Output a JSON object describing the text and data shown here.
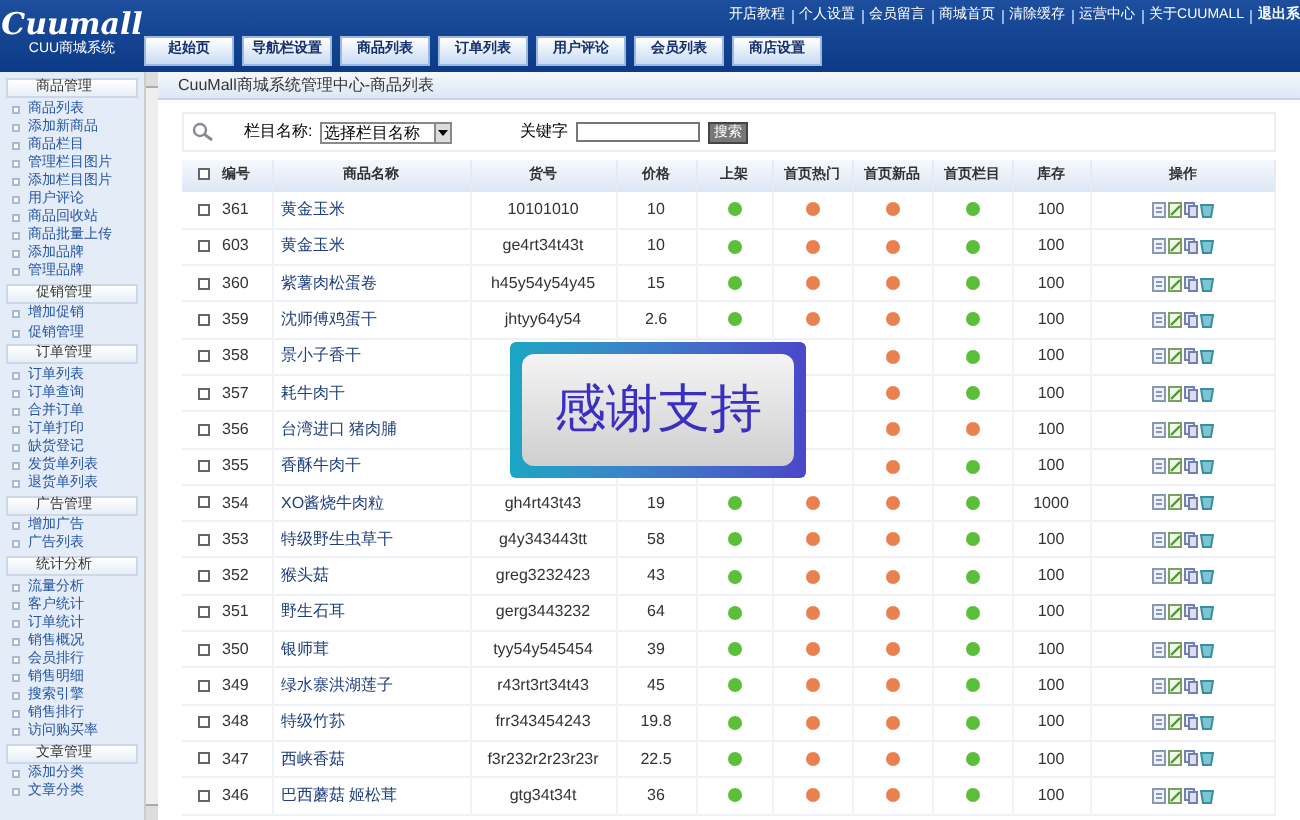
{
  "logo": {
    "title": "Cuumall",
    "subtitle": "CUU商城系统"
  },
  "top_links": [
    "开店教程",
    "个人设置",
    "会员留言",
    "商城首页",
    "清除缓存",
    "运营中心",
    "关于CUUMALL",
    "退出系"
  ],
  "nav_tabs": [
    {
      "label": "起始页",
      "selected": false
    },
    {
      "label": "导航栏设置",
      "selected": false
    },
    {
      "label": "商品列表",
      "selected": false
    },
    {
      "label": "订单列表",
      "selected": false
    },
    {
      "label": "用户评论",
      "selected": false
    },
    {
      "label": "会员列表",
      "selected": false
    },
    {
      "label": "商店设置",
      "selected": false
    }
  ],
  "sidebar": [
    {
      "title": "商品管理",
      "items": [
        "商品列表",
        "添加新商品",
        "商品栏目",
        "管理栏目图片",
        "添加栏目图片",
        "用户评论",
        "商品回收站",
        "商品批量上传",
        "添加品牌",
        "管理品牌"
      ]
    },
    {
      "title": "促销管理",
      "items": [
        "增加促销",
        "促销管理"
      ]
    },
    {
      "title": "订单管理",
      "items": [
        "订单列表",
        "订单查询",
        "合并订单",
        "订单打印",
        "缺货登记",
        "发货单列表",
        "退货单列表"
      ]
    },
    {
      "title": "广告管理",
      "items": [
        "增加广告",
        "广告列表"
      ]
    },
    {
      "title": "统计分析",
      "items": [
        "流量分析",
        "客户统计",
        "订单统计",
        "销售概况",
        "会员排行",
        "销售明细",
        "搜索引擎",
        "销售排行",
        "访问购买率"
      ]
    },
    {
      "title": "文章管理",
      "items": [
        "添加分类",
        "文章分类"
      ]
    }
  ],
  "breadcrumb": "CuuMall商城系统管理中心-商品列表",
  "search": {
    "category_label": "栏目名称:",
    "category_value": "选择栏目名称",
    "keyword_label": "关键字",
    "button": "搜索"
  },
  "table": {
    "select_all_checked": false,
    "columns": [
      "编号",
      "商品名称",
      "货号",
      "价格",
      "上架",
      "首页热门",
      "首页新品",
      "首页栏目",
      "库存",
      "操作"
    ],
    "rows": [
      {
        "checked": false,
        "id": "361",
        "name": "黄金玉米",
        "sku": "10101010",
        "price": "10",
        "on_sale": true,
        "hot": false,
        "new": false,
        "featured": true,
        "stock": "100"
      },
      {
        "checked": false,
        "id": "603",
        "name": "黄金玉米",
        "sku": "ge4rt34t43t",
        "price": "10",
        "on_sale": true,
        "hot": false,
        "new": false,
        "featured": true,
        "stock": "100"
      },
      {
        "checked": false,
        "id": "360",
        "name": "紫薯肉松蛋卷",
        "sku": "h45y54y54y45",
        "price": "15",
        "on_sale": true,
        "hot": false,
        "new": false,
        "featured": true,
        "stock": "100"
      },
      {
        "checked": false,
        "id": "359",
        "name": "沈师傅鸡蛋干",
        "sku": "jhtyy64y54",
        "price": "2.6",
        "on_sale": true,
        "hot": false,
        "new": false,
        "featured": true,
        "stock": "100"
      },
      {
        "checked": false,
        "id": "358",
        "name": "景小子香干",
        "sku": null,
        "price": null,
        "on_sale": null,
        "hot": null,
        "new": false,
        "featured": true,
        "stock": "100"
      },
      {
        "checked": false,
        "id": "357",
        "name": "耗牛肉干",
        "sku": null,
        "price": null,
        "on_sale": null,
        "hot": null,
        "new": false,
        "featured": true,
        "stock": "100"
      },
      {
        "checked": false,
        "id": "356",
        "name": "台湾进口 猪肉脯",
        "sku": null,
        "price": null,
        "on_sale": null,
        "hot": null,
        "new": false,
        "featured": false,
        "stock": "100"
      },
      {
        "checked": false,
        "id": "355",
        "name": "香酥牛肉干",
        "sku": null,
        "price": null,
        "on_sale": null,
        "hot": null,
        "new": false,
        "featured": true,
        "stock": "100"
      },
      {
        "checked": false,
        "id": "354",
        "name": "XO酱烧牛肉粒",
        "sku": "gh4rt43t43",
        "price": "19",
        "on_sale": true,
        "hot": false,
        "new": false,
        "featured": true,
        "stock": "1000"
      },
      {
        "checked": false,
        "id": "353",
        "name": "特级野生虫草干",
        "sku": "g4y343443tt",
        "price": "58",
        "on_sale": true,
        "hot": false,
        "new": false,
        "featured": true,
        "stock": "100"
      },
      {
        "checked": false,
        "id": "352",
        "name": "猴头菇",
        "sku": "greg3232423",
        "price": "43",
        "on_sale": true,
        "hot": false,
        "new": false,
        "featured": true,
        "stock": "100"
      },
      {
        "checked": false,
        "id": "351",
        "name": "野生石耳",
        "sku": "gerg3443232",
        "price": "64",
        "on_sale": true,
        "hot": false,
        "new": false,
        "featured": true,
        "stock": "100"
      },
      {
        "checked": false,
        "id": "350",
        "name": "银师茸",
        "sku": "tyy54y545454",
        "price": "39",
        "on_sale": true,
        "hot": false,
        "new": false,
        "featured": true,
        "stock": "100"
      },
      {
        "checked": false,
        "id": "349",
        "name": "绿水寨洪湖莲子",
        "sku": "r43rt3rt34t43",
        "price": "45",
        "on_sale": true,
        "hot": false,
        "new": false,
        "featured": true,
        "stock": "100"
      },
      {
        "checked": false,
        "id": "348",
        "name": "特级竹荪",
        "sku": "frr343454243",
        "price": "19.8",
        "on_sale": true,
        "hot": false,
        "new": false,
        "featured": true,
        "stock": "100"
      },
      {
        "checked": false,
        "id": "347",
        "name": "西峡香菇",
        "sku": "f3r232r2r23r23r",
        "price": "22.5",
        "on_sale": true,
        "hot": false,
        "new": false,
        "featured": true,
        "stock": "100"
      },
      {
        "checked": false,
        "id": "346",
        "name": "巴西蘑菇 姬松茸",
        "sku": "gtg34t34t",
        "price": "36",
        "on_sale": true,
        "hot": false,
        "new": false,
        "featured": true,
        "stock": "100"
      }
    ]
  },
  "overlay": {
    "text": "感谢支持"
  }
}
